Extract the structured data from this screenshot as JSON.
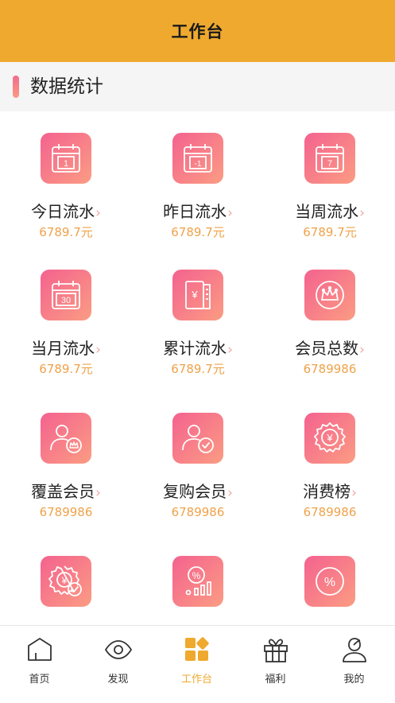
{
  "header": {
    "title": "工作台"
  },
  "section": {
    "title": "数据统计"
  },
  "colors": {
    "accent": "#EFA92F",
    "icon_gradient_start": "#F4628F",
    "icon_gradient_end": "#FB9C83",
    "value_color": "#EFA24A"
  },
  "stats": [
    {
      "icon": "calendar-1-icon",
      "icon_text": "1",
      "label": "今日流水",
      "value": "6789.7元"
    },
    {
      "icon": "calendar-minus1-icon",
      "icon_text": "-1",
      "label": "昨日流水",
      "value": "6789.7元"
    },
    {
      "icon": "calendar-7-icon",
      "icon_text": "7",
      "label": "当周流水",
      "value": "6789.7元"
    },
    {
      "icon": "calendar-30-icon",
      "icon_text": "30",
      "label": "当月流水",
      "value": "6789.7元"
    },
    {
      "icon": "ledger-yen-icon",
      "icon_text": "¥",
      "label": "累计流水",
      "value": "6789.7元"
    },
    {
      "icon": "crown-icon",
      "label": "会员总数",
      "value": "6789986"
    },
    {
      "icon": "member-crown-icon",
      "label": "覆盖会员",
      "value": "6789986"
    },
    {
      "icon": "member-check-icon",
      "label": "复购会员",
      "value": "6789986"
    },
    {
      "icon": "yen-badge-icon",
      "icon_text": "¥",
      "label": "消费榜",
      "value": "6789986"
    },
    {
      "icon": "yen-badge-check-icon",
      "icon_text": "¥"
    },
    {
      "icon": "percent-chart-icon",
      "icon_text": "%"
    },
    {
      "icon": "percent-circle-icon",
      "icon_text": "%"
    }
  ],
  "tabbar": {
    "active": 2,
    "items": [
      {
        "icon": "home-icon",
        "label": "首页"
      },
      {
        "icon": "eye-icon",
        "label": "发现"
      },
      {
        "icon": "workbench-icon",
        "label": "工作台"
      },
      {
        "icon": "gift-icon",
        "label": "福利"
      },
      {
        "icon": "profile-icon",
        "label": "我的"
      }
    ]
  }
}
